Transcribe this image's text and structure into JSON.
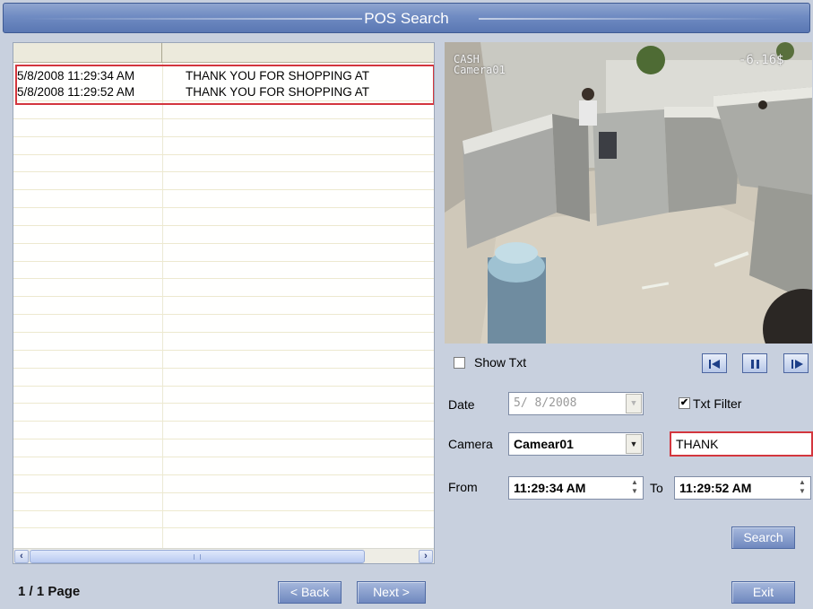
{
  "window": {
    "title": "POS Search"
  },
  "list": {
    "rows": [
      {
        "time": "5/8/2008 11:29:34 AM",
        "text": "THANK YOU FOR SHOPPING AT"
      },
      {
        "time": "5/8/2008 11:29:52 AM",
        "text": "THANK YOU FOR SHOPPING AT"
      }
    ]
  },
  "pager": {
    "label": "1 / 1 Page",
    "back_label": "< Back",
    "next_label": "Next >"
  },
  "video": {
    "osd_line1": "CASH",
    "osd_line2": "Camera01",
    "osd_amount": "-6.16$"
  },
  "playback": {
    "show_txt_label": "Show Txt",
    "show_txt_checked": ""
  },
  "filters": {
    "date_label": "Date",
    "date_value": "5/ 8/2008",
    "txt_filter_label": "Txt Filter",
    "txt_filter_checked": "✔",
    "camera_label": "Camera",
    "camera_value": "Camear01",
    "txt_filter_value": "THANK",
    "from_label": "From",
    "from_value": "11:29:34 AM",
    "to_label": "To",
    "to_value": "11:29:52 AM"
  },
  "actions": {
    "search_label": "Search",
    "exit_label": "Exit"
  },
  "icons": {
    "first": "skip-to-start-icon",
    "pause": "pause-icon",
    "play": "play-step-icon"
  }
}
